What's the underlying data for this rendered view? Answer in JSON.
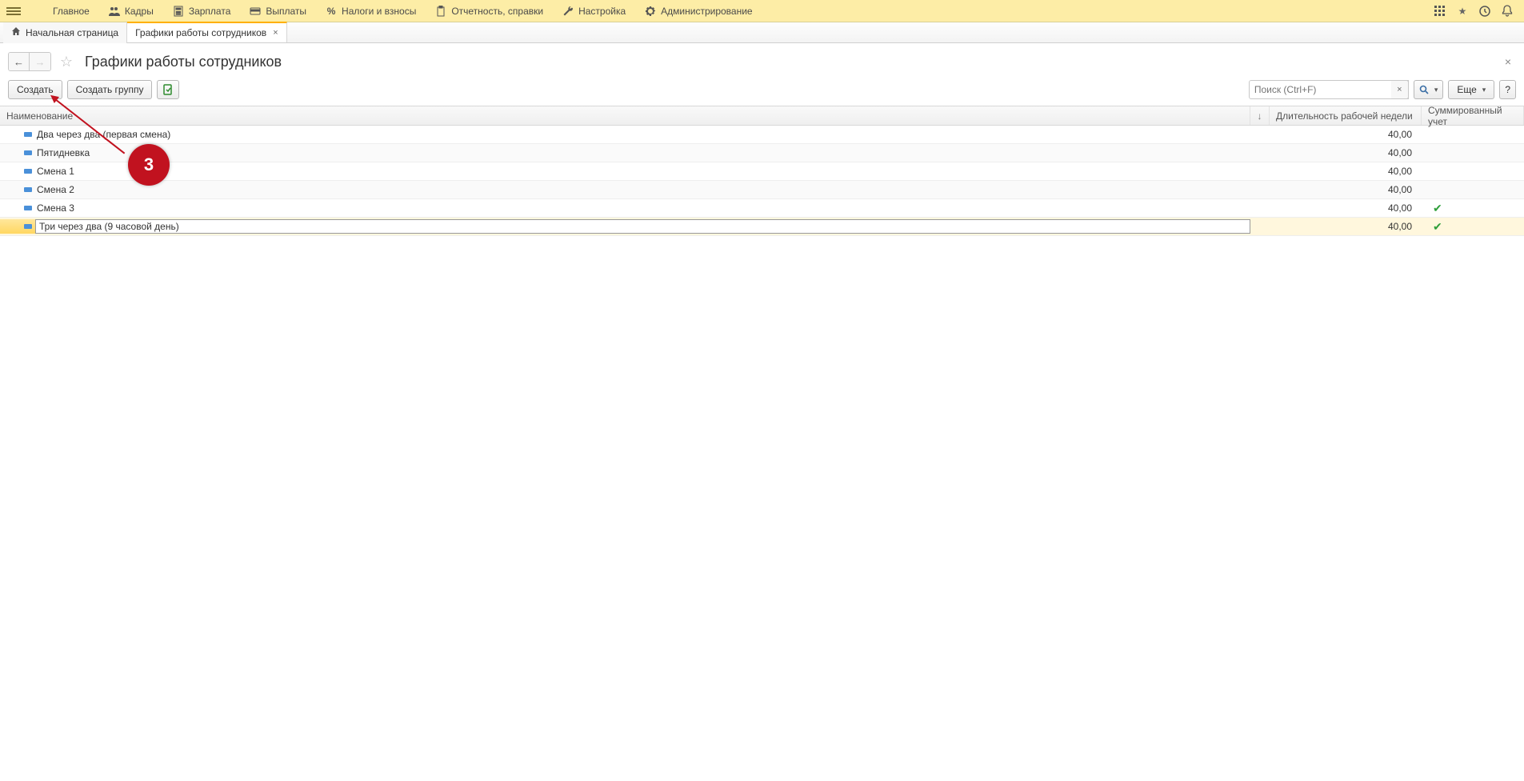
{
  "topmenu": [
    {
      "icon": "menu",
      "label": "Главное"
    },
    {
      "icon": "people",
      "label": "Кадры"
    },
    {
      "icon": "calc",
      "label": "Зарплата"
    },
    {
      "icon": "card",
      "label": "Выплаты"
    },
    {
      "icon": "percent",
      "label": "Налоги и взносы"
    },
    {
      "icon": "clipboard",
      "label": "Отчетность, справки"
    },
    {
      "icon": "wrench",
      "label": "Настройка"
    },
    {
      "icon": "gear",
      "label": "Администрирование"
    }
  ],
  "tabs": {
    "home": "Начальная страница",
    "active": "Графики работы сотрудников"
  },
  "page": {
    "title": "Графики работы сотрудников"
  },
  "toolbar": {
    "create": "Создать",
    "create_group": "Создать группу",
    "search_placeholder": "Поиск (Ctrl+F)",
    "more": "Еще",
    "help": "?"
  },
  "columns": {
    "name": "Наименование",
    "duration": "Длительность рабочей недели",
    "summed": "Суммированный учет"
  },
  "rows": [
    {
      "name": "Два через два (первая смена)",
      "dur": "40,00",
      "sum": false,
      "selected": false
    },
    {
      "name": "Пятидневка",
      "dur": "40,00",
      "sum": false,
      "selected": false
    },
    {
      "name": "Смена 1",
      "dur": "40,00",
      "sum": false,
      "selected": false
    },
    {
      "name": "Смена 2",
      "dur": "40,00",
      "sum": false,
      "selected": false
    },
    {
      "name": "Смена 3",
      "dur": "40,00",
      "sum": true,
      "selected": false
    },
    {
      "name": "Три через два (9 часовой день)",
      "dur": "40,00",
      "sum": true,
      "selected": true
    }
  ],
  "annotation": {
    "label": "3"
  }
}
